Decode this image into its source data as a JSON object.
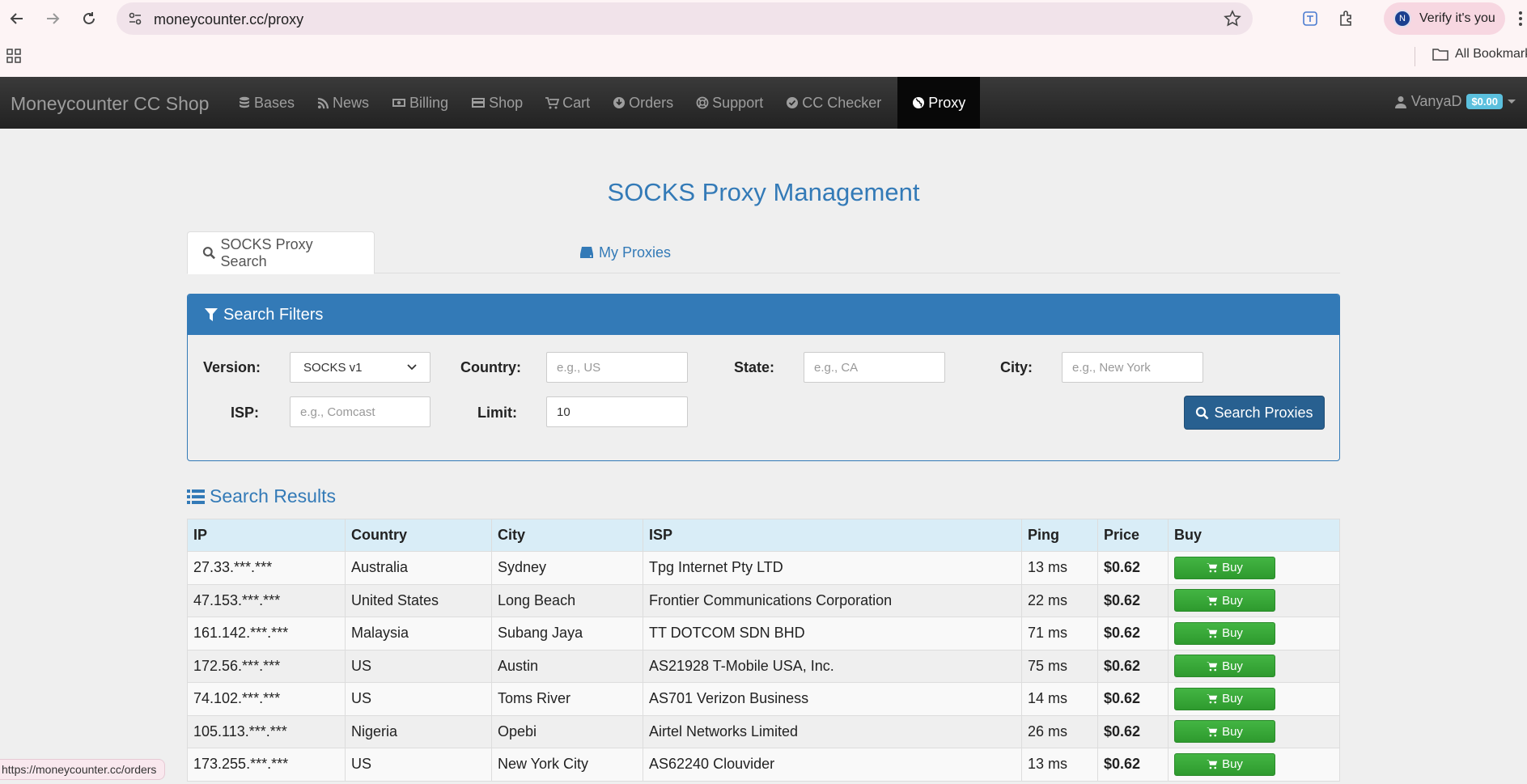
{
  "browser": {
    "url": "moneycounter.cc/proxy",
    "verify_label": "Verify it's you",
    "profile_initial": "N",
    "bookmarks_label": "All Bookmarks",
    "status_url": "https://moneycounter.cc/orders"
  },
  "navbar": {
    "brand": "Moneycounter CC Shop",
    "items": [
      {
        "label": "Bases",
        "icon": "database-icon"
      },
      {
        "label": "News",
        "icon": "rss-icon"
      },
      {
        "label": "Billing",
        "icon": "money-icon"
      },
      {
        "label": "Shop",
        "icon": "credit-card-icon"
      },
      {
        "label": "Cart",
        "icon": "cart-icon"
      },
      {
        "label": "Orders",
        "icon": "download-circle-icon"
      },
      {
        "label": "Support",
        "icon": "lifebuoy-icon"
      },
      {
        "label": "CC Checker",
        "icon": "check-circle-icon"
      },
      {
        "label": "Proxy",
        "icon": "globe-icon",
        "active": true
      }
    ],
    "user": "VanyaD",
    "balance": "$0.00"
  },
  "page": {
    "title": "SOCKS Proxy Management",
    "tabs": [
      {
        "label": "SOCKS Proxy Search",
        "active": true
      },
      {
        "label": "My Proxies",
        "active": false
      }
    ]
  },
  "filters": {
    "heading": "Search Filters",
    "version_label": "Version:",
    "version_value": "SOCKS v1",
    "country_label": "Country:",
    "country_placeholder": "e.g., US",
    "state_label": "State:",
    "state_placeholder": "e.g., CA",
    "city_label": "City:",
    "city_placeholder": "e.g., New York",
    "isp_label": "ISP:",
    "isp_placeholder": "e.g., Comcast",
    "limit_label": "Limit:",
    "limit_value": "10",
    "search_button": "Search Proxies"
  },
  "results": {
    "heading": "Search Results",
    "columns": [
      "IP",
      "Country",
      "City",
      "ISP",
      "Ping",
      "Price",
      "Buy"
    ],
    "buy_label": "Buy",
    "rows": [
      {
        "ip": "27.33.***.***",
        "country": "Australia",
        "city": "Sydney",
        "isp": "Tpg Internet Pty LTD",
        "ping": "13 ms",
        "price": "$0.62"
      },
      {
        "ip": "47.153.***.***",
        "country": "United States",
        "city": "Long Beach",
        "isp": "Frontier Communications Corporation",
        "ping": "22 ms",
        "price": "$0.62"
      },
      {
        "ip": "161.142.***.***",
        "country": "Malaysia",
        "city": "Subang Jaya",
        "isp": "TT DOTCOM SDN BHD",
        "ping": "71 ms",
        "price": "$0.62"
      },
      {
        "ip": "172.56.***.***",
        "country": "US",
        "city": "Austin",
        "isp": "AS21928 T-Mobile USA, Inc.",
        "ping": "75 ms",
        "price": "$0.62"
      },
      {
        "ip": "74.102.***.***",
        "country": "US",
        "city": "Toms River",
        "isp": "AS701 Verizon Business",
        "ping": "14 ms",
        "price": "$0.62"
      },
      {
        "ip": "105.113.***.***",
        "country": "Nigeria",
        "city": "Opebi",
        "isp": "Airtel Networks Limited",
        "ping": "26 ms",
        "price": "$0.62"
      },
      {
        "ip": "173.255.***.***",
        "country": "US",
        "city": "New York City",
        "isp": "AS62240 Clouvider",
        "ping": "13 ms",
        "price": "$0.62"
      }
    ]
  }
}
